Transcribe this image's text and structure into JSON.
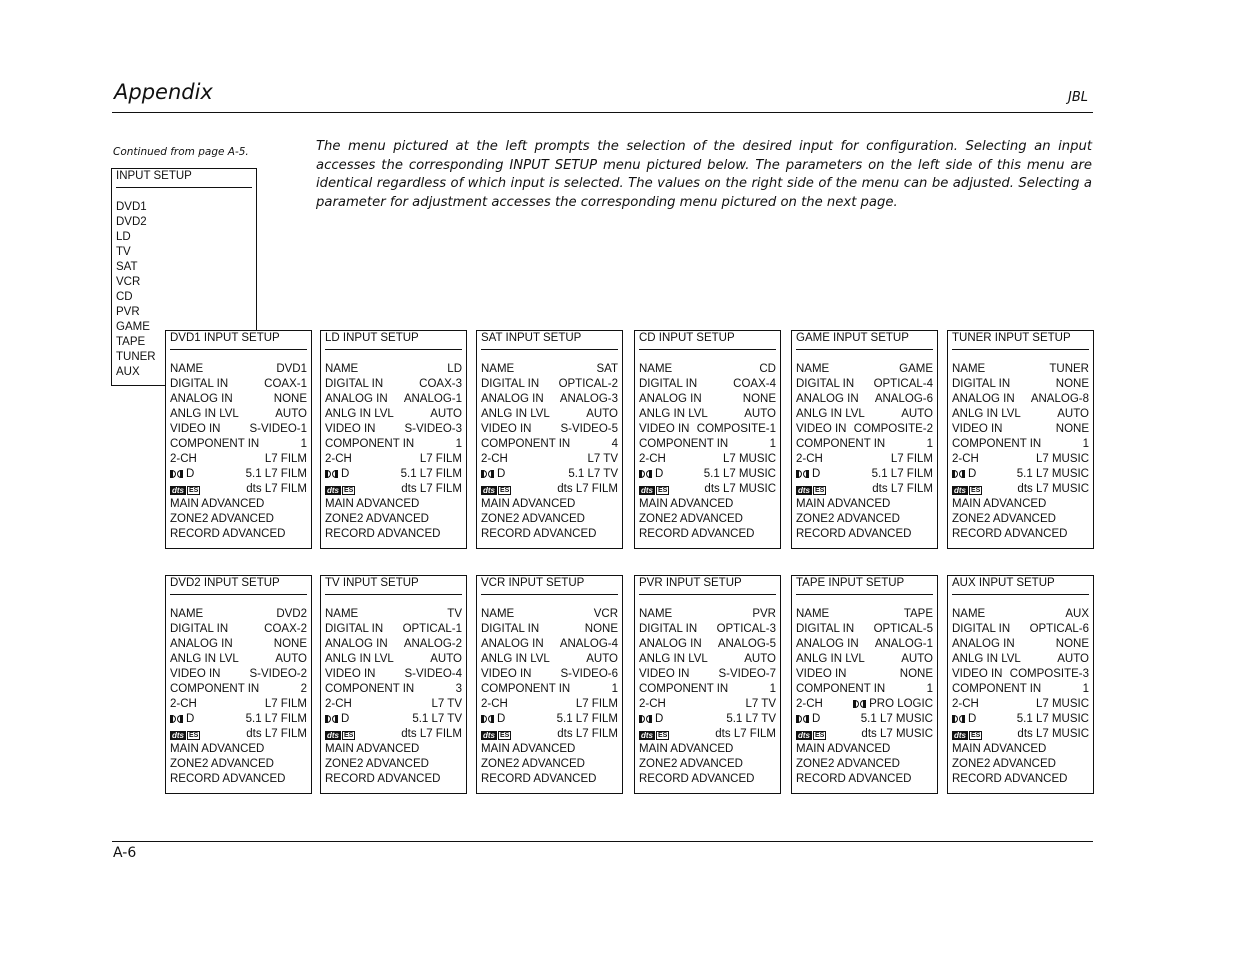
{
  "header": {
    "title": "Appendix",
    "brand": "JBL"
  },
  "footer": {
    "page_number": "A-6"
  },
  "continued_note": "Continued from page A-5.",
  "intro_text": "The menu pictured at the left prompts the selection of the desired input for configuration. Selecting an input accesses the corresponding INPUT SETUP menu pictured below. The parameters on the left side of this menu are identical regardless of which input is selected. The values on the right side of the menu can be adjusted. Selecting a parameter for adjustment accesses the corresponding menu pictured on the next page.",
  "input_menu": {
    "title": "INPUT SETUP",
    "items": [
      "DVD1",
      "DVD2",
      "LD",
      "TV",
      "SAT",
      "VCR",
      "CD",
      "PVR",
      "GAME",
      "TAPE",
      "TUNER",
      "AUX"
    ]
  },
  "param_labels": {
    "name": "NAME",
    "digital_in": "DIGITAL IN",
    "analog_in": "ANALOG IN",
    "anlg_in_lvl": "ANLG IN LVL",
    "video_in": "VIDEO IN",
    "component_in": "COMPONENT IN",
    "two_ch": "2-CH",
    "dolby_d": "D",
    "dts_es_icon": "dts-es-logo",
    "dolby_icon": "dolby-double-d-logo",
    "main_adv": "MAIN ADVANCED",
    "zone2_adv": "ZONE2 ADVANCED",
    "record_adv": "RECORD ADVANCED"
  },
  "setup_menus": [
    {
      "title": "DVD1 INPUT SETUP",
      "name": "DVD1",
      "digital_in": "COAX-1",
      "analog_in": "NONE",
      "anlg_in_lvl": "AUTO",
      "video_in": "S-VIDEO-1",
      "component_in": "1",
      "two_ch": "L7 FILM",
      "dolby_d": "5.1 L7 FILM",
      "dts_es": "dts L7 FILM"
    },
    {
      "title": "LD INPUT SETUP",
      "name": "LD",
      "digital_in": "COAX-3",
      "analog_in": "ANALOG-1",
      "anlg_in_lvl": "AUTO",
      "video_in": "S-VIDEO-3",
      "component_in": "1",
      "two_ch": "L7 FILM",
      "dolby_d": "5.1 L7 FILM",
      "dts_es": "dts L7 FILM"
    },
    {
      "title": "SAT INPUT SETUP",
      "name": "SAT",
      "digital_in": "OPTICAL-2",
      "analog_in": "ANALOG-3",
      "anlg_in_lvl": "AUTO",
      "video_in": "S-VIDEO-5",
      "component_in": "4",
      "two_ch": "L7 TV",
      "dolby_d": "5.1 L7 TV",
      "dts_es": "dts L7 FILM"
    },
    {
      "title": "CD INPUT SETUP",
      "name": "CD",
      "digital_in": "COAX-4",
      "analog_in": "NONE",
      "anlg_in_lvl": "AUTO",
      "video_in": "COMPOSITE-1",
      "component_in": "1",
      "two_ch": "L7 MUSIC",
      "dolby_d": "5.1 L7 MUSIC",
      "dts_es": "dts L7 MUSIC"
    },
    {
      "title": "GAME INPUT SETUP",
      "name": "GAME",
      "digital_in": "OPTICAL-4",
      "analog_in": "ANALOG-6",
      "anlg_in_lvl": "AUTO",
      "video_in": "COMPOSITE-2",
      "component_in": "1",
      "two_ch": "L7 FILM",
      "dolby_d": "5.1 L7 FILM",
      "dts_es": "dts L7 FILM"
    },
    {
      "title": "TUNER INPUT SETUP",
      "name": "TUNER",
      "digital_in": "NONE",
      "analog_in": "ANALOG-8",
      "anlg_in_lvl": "AUTO",
      "video_in": "NONE",
      "component_in": "1",
      "two_ch": "L7 MUSIC",
      "dolby_d": "5.1 L7 MUSIC",
      "dts_es": "dts L7 MUSIC"
    },
    {
      "title": "DVD2 INPUT SETUP",
      "name": "DVD2",
      "digital_in": "COAX-2",
      "analog_in": "NONE",
      "anlg_in_lvl": "AUTO",
      "video_in": "S-VIDEO-2",
      "component_in": "2",
      "two_ch": "L7 FILM",
      "dolby_d": "5.1 L7 FILM",
      "dts_es": "dts L7 FILM"
    },
    {
      "title": "TV INPUT SETUP",
      "name": "TV",
      "digital_in": "OPTICAL-1",
      "analog_in": "ANALOG-2",
      "anlg_in_lvl": "AUTO",
      "video_in": "S-VIDEO-4",
      "component_in": "3",
      "two_ch": "L7 TV",
      "dolby_d": "5.1 L7 TV",
      "dts_es": "dts L7 FILM"
    },
    {
      "title": "VCR INPUT SETUP",
      "name": "VCR",
      "digital_in": "NONE",
      "analog_in": "ANALOG-4",
      "anlg_in_lvl": "AUTO",
      "video_in": "S-VIDEO-6",
      "component_in": "1",
      "two_ch": "L7 FILM",
      "dolby_d": "5.1 L7 FILM",
      "dts_es": "dts L7 FILM"
    },
    {
      "title": "PVR INPUT SETUP",
      "name": "PVR",
      "digital_in": "OPTICAL-3",
      "analog_in": "ANALOG-5",
      "anlg_in_lvl": "AUTO",
      "video_in": "S-VIDEO-7",
      "component_in": "1",
      "two_ch": "L7 TV",
      "dolby_d": "5.1 L7 TV",
      "dts_es": "dts L7 FILM"
    },
    {
      "title": "TAPE INPUT SETUP",
      "name": "TAPE",
      "digital_in": "OPTICAL-5",
      "analog_in": "ANALOG-1",
      "anlg_in_lvl": "AUTO",
      "video_in": "NONE",
      "component_in": "1",
      "two_ch": "PRO LOGIC",
      "two_ch_dolby_icon": true,
      "dolby_d": "5.1 L7 MUSIC",
      "dts_es": "dts L7 MUSIC"
    },
    {
      "title": "AUX INPUT SETUP",
      "name": "AUX",
      "digital_in": "OPTICAL-6",
      "analog_in": "NONE",
      "anlg_in_lvl": "AUTO",
      "video_in": "COMPOSITE-3",
      "component_in": "1",
      "two_ch": "L7 MUSIC",
      "dolby_d": "5.1 L7 MUSIC",
      "dts_es": "dts L7 MUSIC"
    }
  ]
}
